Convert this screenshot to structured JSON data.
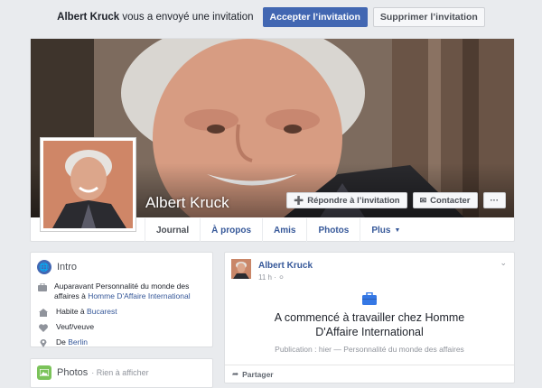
{
  "invite": {
    "sender": "Albert Kruck",
    "message": "vous a envoyé une invitation",
    "accept_label": "Accepter l’invitation",
    "delete_label": "Supprimer l’invitation"
  },
  "profile": {
    "name": "Albert Kruck",
    "reply_label": "Répondre à l’invitation",
    "contact_label": "Contacter",
    "more_label": "···"
  },
  "tabs": [
    {
      "label": "Journal"
    },
    {
      "label": "À propos"
    },
    {
      "label": "Amis"
    },
    {
      "label": "Photos"
    },
    {
      "label": "Plus"
    }
  ],
  "intro": {
    "title": "Intro",
    "work_prefix": "Auparavant Personnalité du monde des affaires à",
    "work_link": "Homme D'Affaire International",
    "lives_prefix": "Habite à",
    "lives_link": "Bucarest",
    "relationship": "Veuf/veuve",
    "from_prefix": "De",
    "from_link": "Berlin"
  },
  "photos": {
    "title": "Photos",
    "subtitle": "· Rien à afficher"
  },
  "post": {
    "author": "Albert Kruck",
    "time": "11 h",
    "headline": "A commencé à travailler chez Homme D'Affaire International",
    "subline": "Publication : hier — Personnalité du monde des affaires",
    "share_label": "Partager"
  },
  "colors": {
    "brand": "#4267b2",
    "link": "#365899",
    "intro_icon": "#4267b2",
    "photos_icon": "#7bc35a",
    "work_icon": "#3578e5"
  }
}
